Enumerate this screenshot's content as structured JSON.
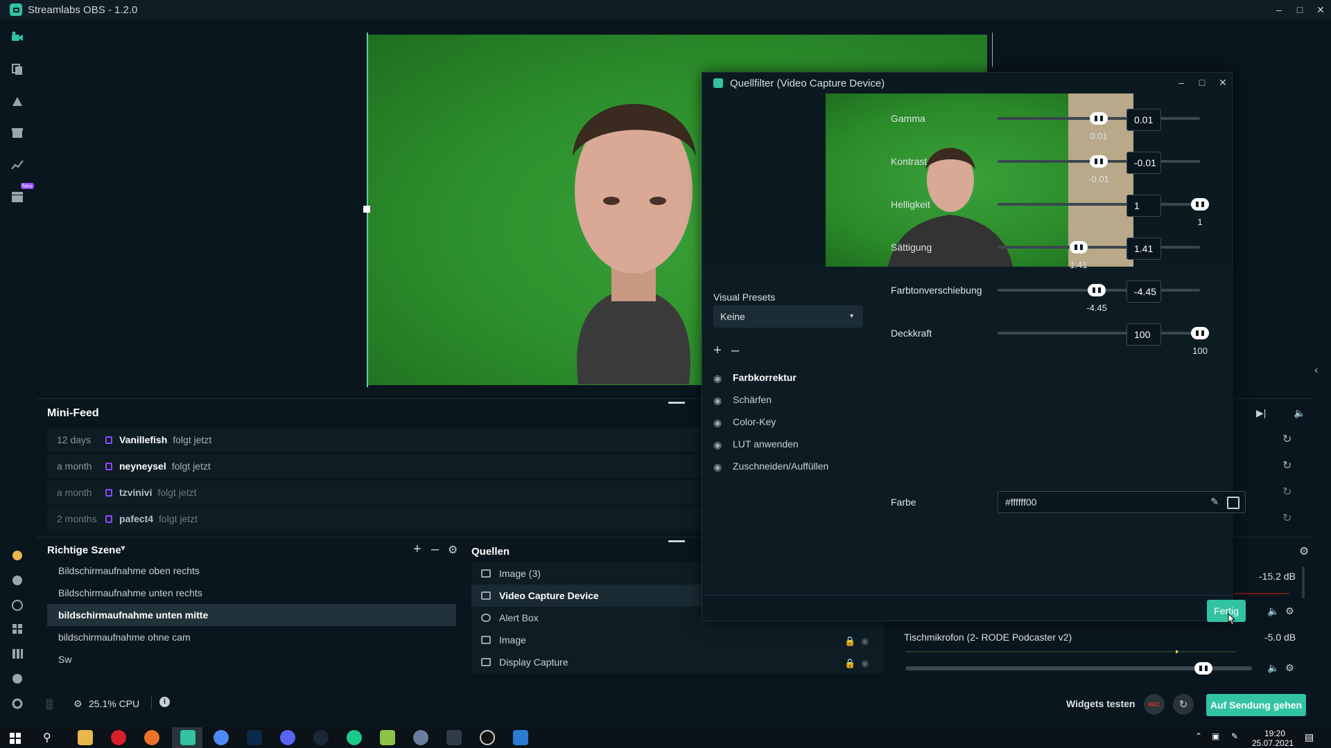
{
  "window": {
    "title": "Streamlabs OBS - 1.2.0"
  },
  "nav": {
    "new_badge": "Neu"
  },
  "minifeed": {
    "title": "Mini-Feed",
    "items": [
      {
        "age": "12 days",
        "user": "Vanillefish",
        "action": "folgt jetzt"
      },
      {
        "age": "a month",
        "user": "neyneysel",
        "action": "folgt jetzt"
      },
      {
        "age": "a month",
        "user": "tzvinivi",
        "action": "folgt jetzt"
      },
      {
        "age": "2 months",
        "user": "pafect4",
        "action": "folgt jetzt"
      }
    ]
  },
  "scenes": {
    "title": "Richtige Szene",
    "items": [
      "Bildschirmaufnahme oben rechts",
      "Bildschirmaufnahme unten rechts",
      "bildschirmaufnahme unten mitte",
      "bildschirmaufnahme ohne cam",
      "Sw"
    ],
    "selected_index": 2
  },
  "sources": {
    "title": "Quellen",
    "items": [
      "Image (3)",
      "Video Capture Device",
      "Alert Box",
      "Image",
      "Display Capture"
    ],
    "selected_index": 1
  },
  "mixer": {
    "level1": "-15.2 dB",
    "mic_name": "Tischmikrofon (2- RODE Podcaster v2)",
    "mic_level": "-5.0 dB",
    "mic_volume_fraction": 0.86
  },
  "bottombar": {
    "cpu": "25.1% CPU",
    "test_widgets": "Widgets testen",
    "rec": "REC",
    "go_live": "Auf Sendung gehen"
  },
  "taskbar": {
    "time": "19:20",
    "date": "25.07.2021"
  },
  "dialog": {
    "title": "Quellfilter (Video Capture Device)",
    "presets_label": "Visual Presets",
    "preset_value": "Keine",
    "filters": [
      "Farbkorrektur",
      "Schärfen",
      "Color-Key",
      "LUT anwenden",
      "Zuschneiden/Auffüllen"
    ],
    "selected_filter": 0,
    "props": [
      {
        "label": "Gamma",
        "value": "0.01",
        "fraction": 0.5
      },
      {
        "label": "Kontrast",
        "value": "-0.01",
        "fraction": 0.5
      },
      {
        "label": "Helligkeit",
        "value": "1",
        "fraction": 1.0
      },
      {
        "label": "Sättigung",
        "value": "1.41",
        "fraction": 0.4
      },
      {
        "label": "Farbtonverschiebung",
        "value": "-4.45",
        "fraction": 0.49
      },
      {
        "label": "Deckkraft",
        "value": "100",
        "fraction": 1.0
      }
    ],
    "color_label": "Farbe",
    "color_value": "#ffffff00",
    "done": "Fertig"
  },
  "colors": {
    "accent": "#31c3a2",
    "bg": "#09161d",
    "twitch": "#9147ff"
  }
}
